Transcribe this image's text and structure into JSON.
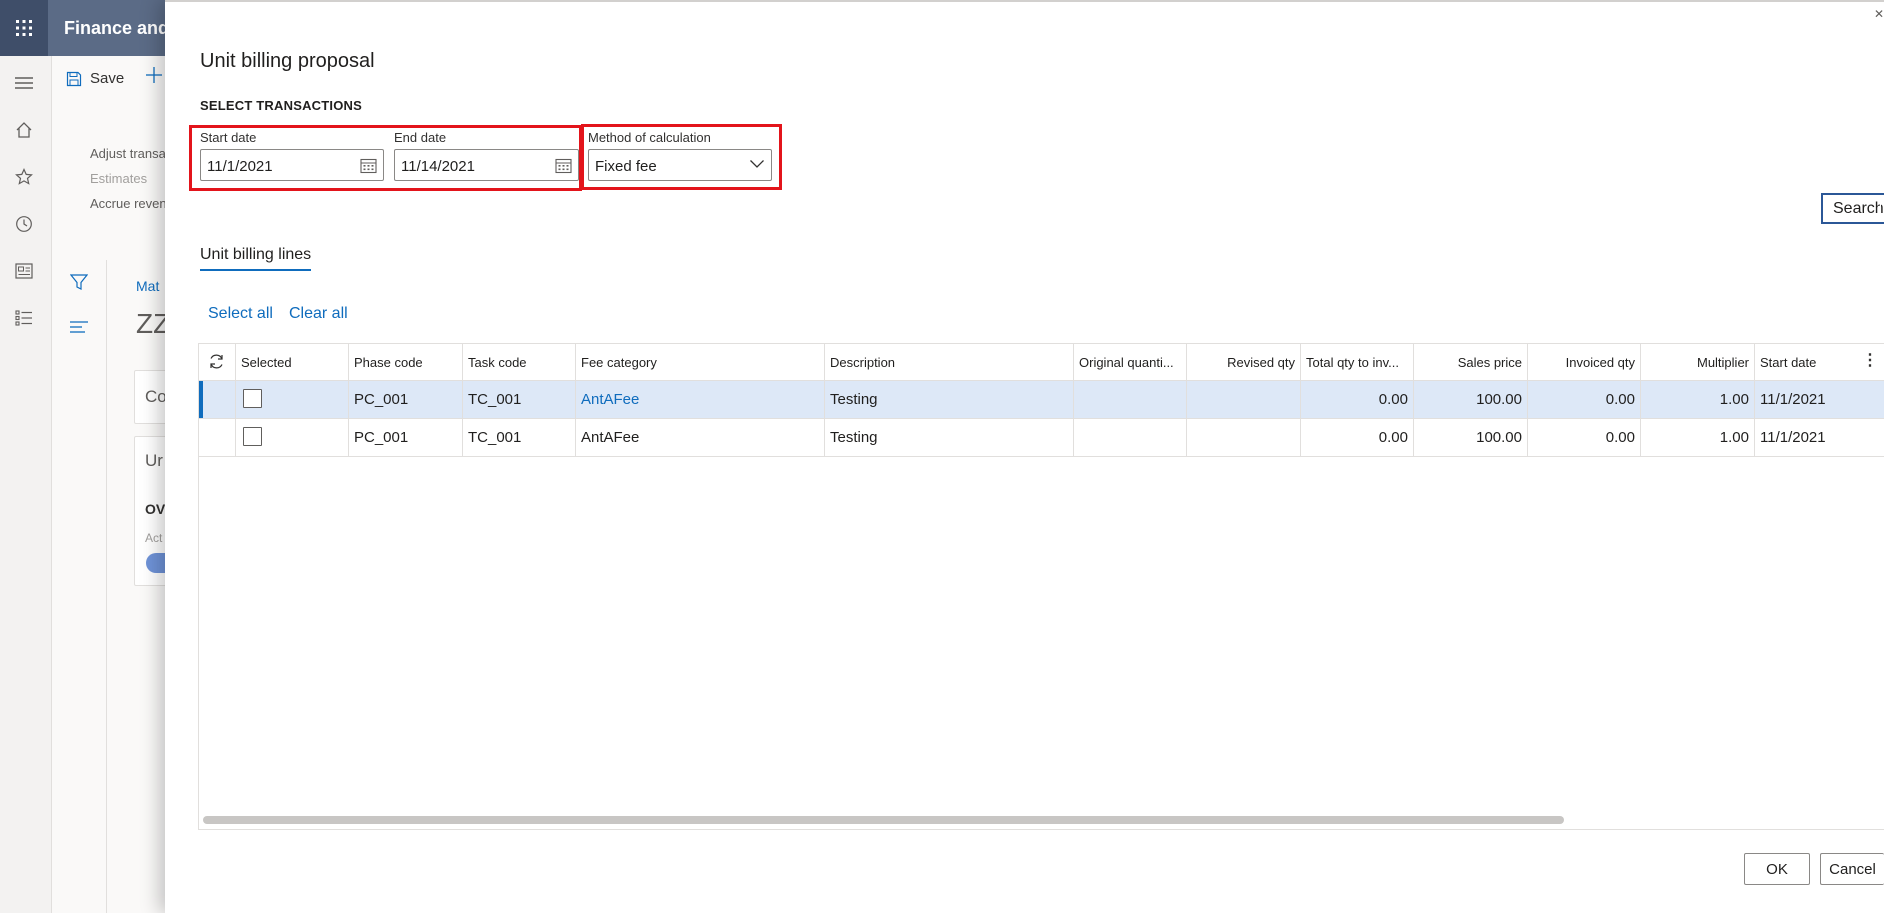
{
  "app": {
    "title": "Finance and"
  },
  "background": {
    "actions": {
      "save_label": "Save"
    },
    "menu": [
      "Adjust transa",
      "Estimates",
      "Accrue reven"
    ],
    "breadcrumb": "Mat",
    "heading": "ZZ",
    "cards": [
      "Co",
      "Ur"
    ],
    "overview": {
      "title": "OV",
      "label": "Act"
    }
  },
  "dialog": {
    "title": "Unit billing proposal",
    "section_title": "SELECT TRANSACTIONS",
    "start_date": {
      "label": "Start date",
      "value": "11/1/2021"
    },
    "end_date": {
      "label": "End date",
      "value": "11/14/2021"
    },
    "method": {
      "label": "Method of calculation",
      "value": "Fixed fee"
    },
    "search_label": "Search",
    "tab_label": "Unit billing lines",
    "select_all_label": "Select all",
    "clear_all_label": "Clear all",
    "grid": {
      "columns": [
        "Selected",
        "Phase code",
        "Task code",
        "Fee category",
        "Description",
        "Original quanti...",
        "Revised qty",
        "Total qty to inv...",
        "Sales price",
        "Invoiced qty",
        "Multiplier",
        "Start date"
      ],
      "rows": [
        {
          "selected": false,
          "phase": "PC_001",
          "task": "TC_001",
          "fee": "AntAFee",
          "desc": "Testing",
          "orig": "",
          "revised": "",
          "total": "0.00",
          "price": "100.00",
          "invoiced": "0.00",
          "mult": "1.00",
          "start": "11/1/2021"
        },
        {
          "selected": false,
          "phase": "PC_001",
          "task": "TC_001",
          "fee": "AntAFee",
          "desc": "Testing",
          "orig": "",
          "revised": "",
          "total": "0.00",
          "price": "100.00",
          "invoiced": "0.00",
          "mult": "1.00",
          "start": "11/1/2021"
        }
      ]
    },
    "ok_label": "OK",
    "cancel_label": "Cancel"
  },
  "colors": {
    "accent": "#0f6cbd",
    "highlight": "#e3141b",
    "topbar": "#5b6b86",
    "selected_row": "#dde8f7"
  }
}
